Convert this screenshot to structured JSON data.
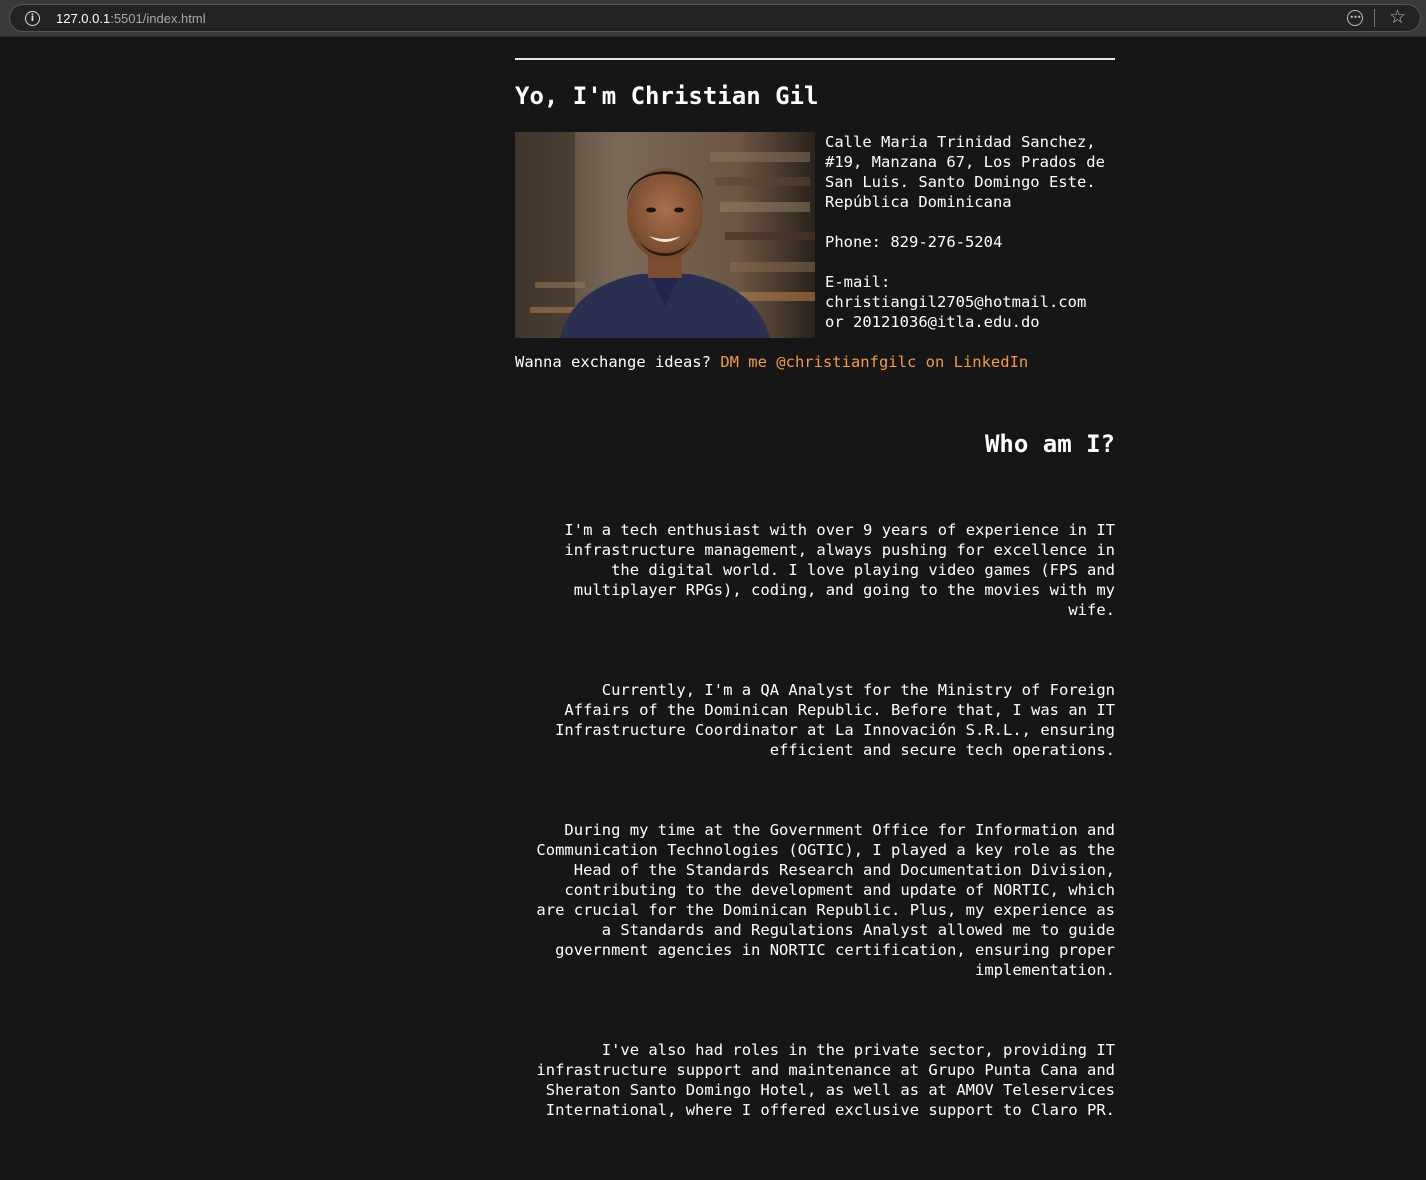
{
  "browser": {
    "url_host": "127.0.0.1",
    "url_rest": ":5501/index.html"
  },
  "page": {
    "title": "Yo, I'm Christian Gil",
    "contact_lines": "Calle Maria Trinidad Sanchez,\n#19, Manzana 67, Los Prados de\nSan Luis. Santo Domingo Este.\nRepública Dominicana\n\nPhone: 829-276-5204\n\nE-mail:\nchristiangil2705@hotmail.com\nor 20121036@itla.edu.do",
    "dm_prefix": "Wanna exchange ideas? ",
    "dm_link": "DM me @christianfgilc on LinkedIn",
    "about_title": "Who am I?",
    "bio": [
      "I'm a tech enthusiast with over 9 years of experience in IT\ninfrastructure management, always pushing for excellence in\nthe digital world. I love playing video games (FPS and\nmultiplayer RPGs), coding, and going to the movies with my\nwife.",
      "Currently, I'm a QA Analyst for the Ministry of Foreign\nAffairs of the Dominican Republic. Before that, I was an IT\nInfrastructure Coordinator at La Innovación S.R.L., ensuring\nefficient and secure tech operations.",
      "During my time at the Government Office for Information and\nCommunication Technologies (OGTIC), I played a key role as the\nHead of the Standards Research and Documentation Division,\ncontributing to the development and update of NORTIC, which\nare crucial for the Dominican Republic. Plus, my experience as\na Standards and Regulations Analyst allowed me to guide\ngovernment agencies in NORTIC certification, ensuring proper\nimplementation.",
      "I've also had roles in the private sector, providing IT\ninfrastructure support and maintenance at Grupo Punta Cana and\nSheraton Santo Domingo Hotel, as well as at AMOV Teleservices\nInternational, where I offered exclusive support to Claro PR."
    ]
  },
  "colors": {
    "background": "#161616",
    "text": "#ffffff",
    "link": "#f29b44"
  },
  "icons": [
    "info-icon",
    "extensions-icon",
    "bookmark-star-icon"
  ]
}
